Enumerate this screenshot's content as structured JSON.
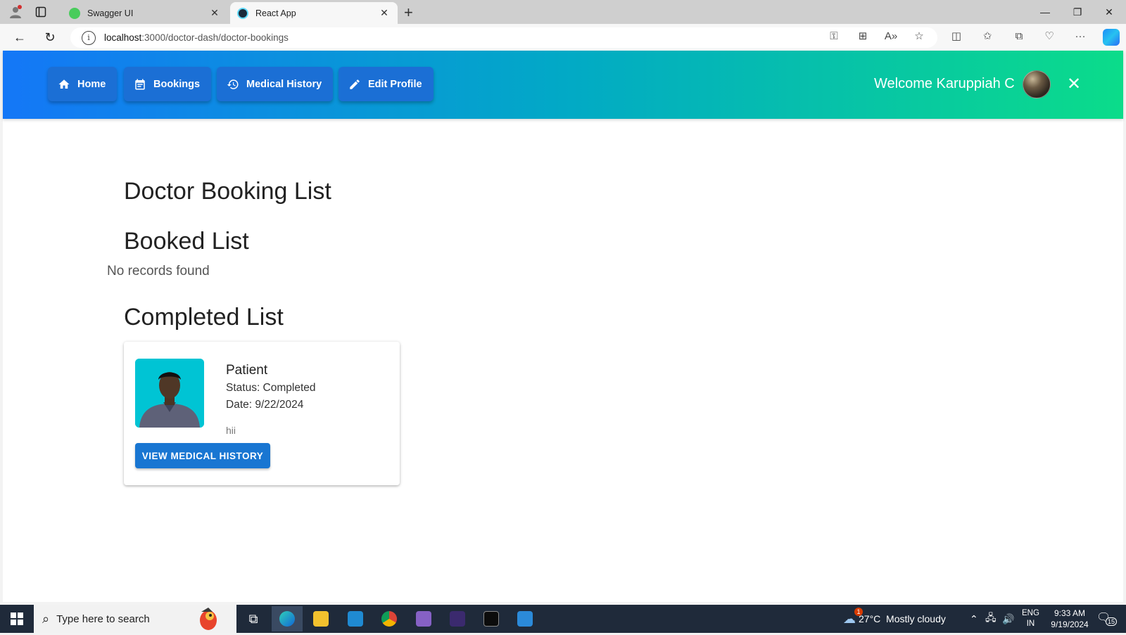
{
  "browser": {
    "tabs": [
      {
        "title": "Swagger UI",
        "favicon_color": "#49cc5c",
        "active": false
      },
      {
        "title": "React App",
        "favicon_color": "#1b2a3a",
        "active": true
      }
    ],
    "address": {
      "host": "localhost",
      "path": ":3000/doctor-dash/doctor-bookings"
    }
  },
  "navbar": {
    "items": [
      {
        "label": "Home",
        "icon": "home-icon"
      },
      {
        "label": "Bookings",
        "icon": "calendar-icon"
      },
      {
        "label": "Medical History",
        "icon": "history-icon"
      },
      {
        "label": "Edit Profile",
        "icon": "pencil-icon"
      }
    ],
    "welcome": "Welcome Karuppiah C",
    "close_icon": "close-icon",
    "gradient_colors": [
      "#1477f7",
      "#02a9c6",
      "#0bdc8a"
    ]
  },
  "main": {
    "page_title": "Doctor Booking List",
    "booked": {
      "heading": "Booked List",
      "empty_text": "No records found"
    },
    "completed": {
      "heading": "Completed List",
      "cards": [
        {
          "title": "Patient",
          "status": "Status: Completed",
          "date": "Date: 9/22/2024",
          "note": "hii",
          "button": "VIEW MEDICAL HISTORY"
        }
      ]
    }
  },
  "taskbar": {
    "search_placeholder": "Type here to search",
    "weather": "27°C  Mostly cloudy",
    "weather_badge": "1",
    "lang": [
      "ENG",
      "IN"
    ],
    "time": "9:33 AM",
    "date": "9/19/2024",
    "notifications": "15"
  }
}
